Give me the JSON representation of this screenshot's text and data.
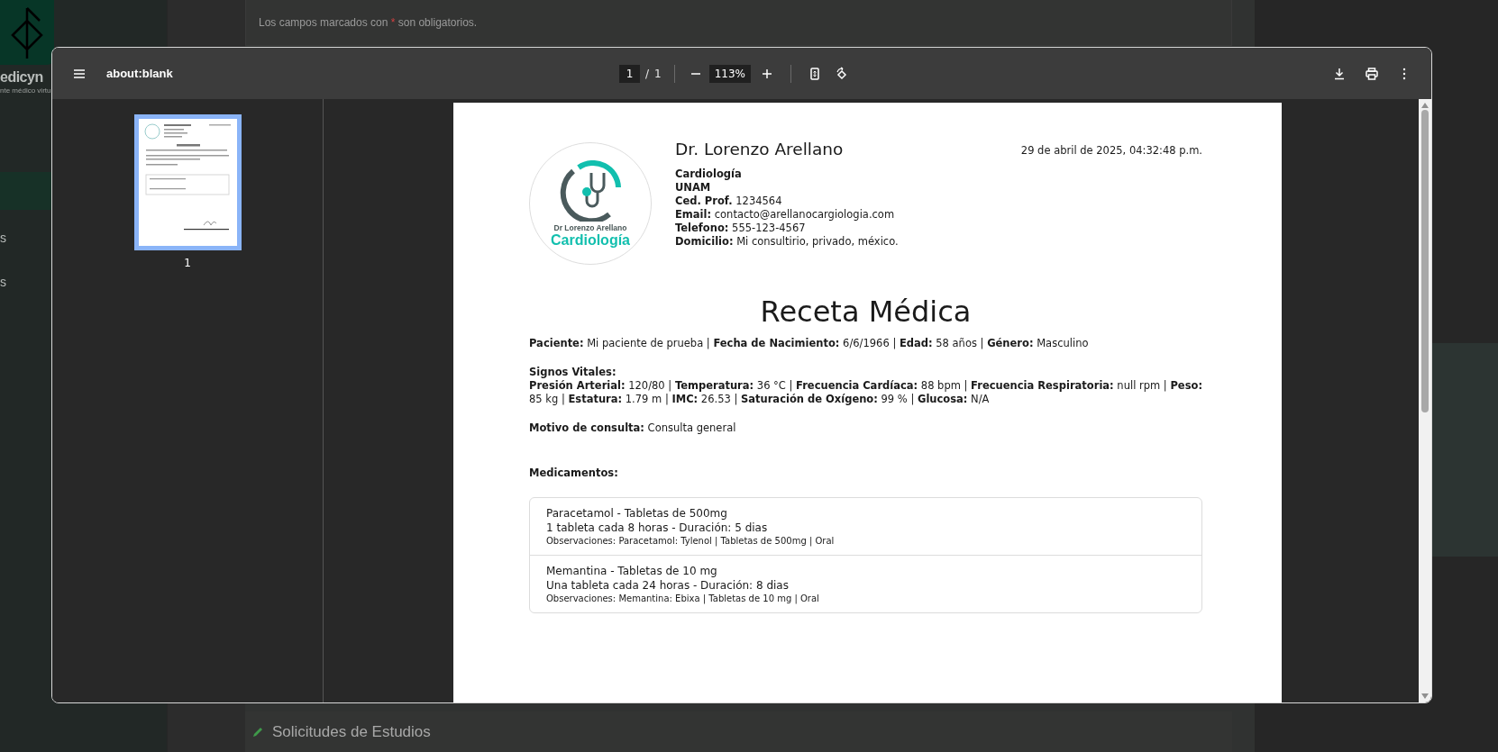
{
  "background_app": {
    "logo_text": "edicyn",
    "logo_subtitle": "nte médico virtu",
    "sidebar_items": [
      {
        "label": "s"
      },
      {
        "label": "s"
      }
    ],
    "form_note": {
      "before": "Los campos marcados con",
      "mark": "*",
      "after": "son obligatorios."
    },
    "section_title": "Solicitudes de Estudios"
  },
  "viewer": {
    "title": "about:blank",
    "page_input": "1",
    "page_separator": "/",
    "page_total": "1",
    "zoom": "113%",
    "thumbnails": [
      {
        "label": "1",
        "selected": true
      }
    ]
  },
  "document": {
    "doctor_name": "Dr. Lorenzo Arellano",
    "date": "29 de abril de 2025, 04:32:48 p.m.",
    "logo": {
      "line_1": "Dr Lorenzo Arellano",
      "line_2": "Cardiología"
    },
    "details": [
      {
        "label": "Cardiología"
      },
      {
        "label": "UNAM"
      },
      {
        "label": "Ced. Prof.",
        "value": "1234564"
      },
      {
        "label": "Email:",
        "value": "contacto@arellanocargiologia.com"
      },
      {
        "label": "Telefono:",
        "value": "555-123-4567"
      },
      {
        "label": "Domicilio:",
        "value": "Mi consultirio, privado, méxico."
      }
    ],
    "title": "Receta Médica",
    "patient_line": "**Paciente:** Mi paciente de prueba | **Fecha de Nacimiento:** 6/6/1966 | **Edad:** 58 años | **Género:** Masculino",
    "vitals_heading": "Signos Vitales:",
    "vitals_text": "**Presión Arterial:** 120/80 | **Temperatura:** 36 °C | **Frecuencia Cardíaca:** 88 bpm | **Frecuencia Respiratoria:** null rpm | **Peso:** 85 kg | **Estatura:** 1.79 m | **IMC:** 26.53 | **Saturación de Oxígeno:** 99 % | **Glucosa:** N/A",
    "reason_line": "**Motivo de consulta:** Consulta general",
    "medications_heading": "Medicamentos:",
    "medications": [
      {
        "name": "Paracetamol - Tabletas de 500mg",
        "dosage": "1 tableta cada 8 horas - Duración: 5 dias",
        "notes": "Observaciones: Paracetamol: Tylenol | Tabletas de 500mg | Oral"
      },
      {
        "name": "Memantina - Tabletas de 10 mg",
        "dosage": "Una tableta cada 24 horas - Duración: 8 dias",
        "notes": "Observaciones: Memantina: Ebixa | Tabletas de 10 mg | Oral"
      }
    ]
  }
}
